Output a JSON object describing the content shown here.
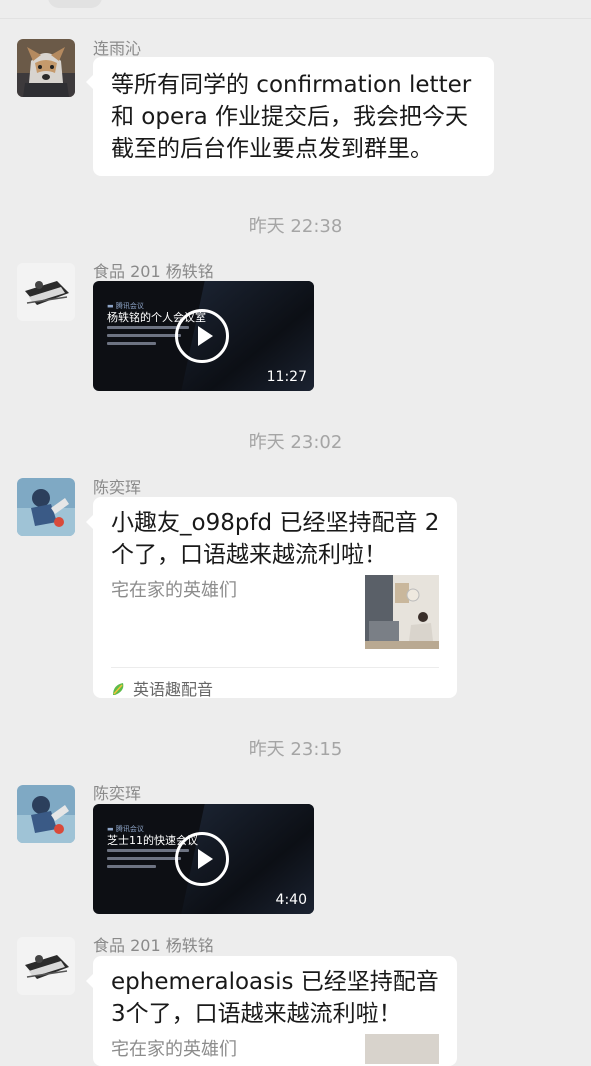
{
  "messages": [
    {
      "sender": "连雨沁",
      "text": "等所有同学的 confirmation letter 和 opera 作业提交后，我会把今天截至的后台作业要点发到群里。"
    },
    {
      "time": "昨天 22:38"
    },
    {
      "sender": "食品 201 杨轶铭",
      "video_title": "杨轶铭的个人会议室",
      "video_duration": "11:27"
    },
    {
      "time": "昨天 23:02"
    },
    {
      "sender": "陈奕珲",
      "card_title": "小趣友_o98pfd 已经坚持配音 2个了，口语越来越流利啦！",
      "card_subtitle": "宅在家的英雄们",
      "card_source": "英语趣配音"
    },
    {
      "time": "昨天 23:15"
    },
    {
      "sender": "陈奕珲",
      "video_title": "芝士11的快速会议",
      "video_duration": "4:40"
    },
    {
      "sender": "食品 201 杨轶铭",
      "card_title": "ephemeraloasis 已经坚持配音 3个了，口语越来越流利啦！",
      "card_subtitle": "宅在家的英雄们"
    }
  ]
}
